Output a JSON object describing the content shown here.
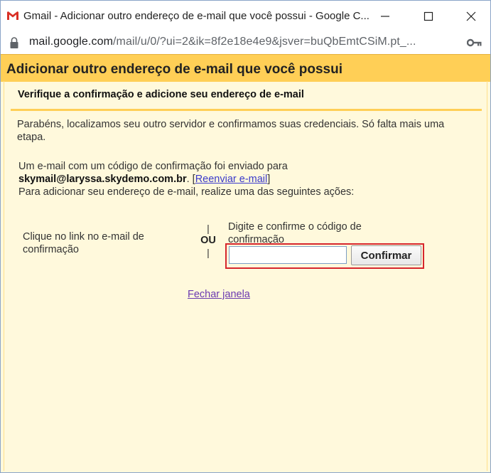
{
  "window": {
    "title": "Gmail - Adicionar outro endereço de e-mail que você possui - Google C...",
    "icon": "gmail-logo",
    "controls": [
      "minimize-icon",
      "maximize-icon",
      "close-icon"
    ]
  },
  "addressbar": {
    "url_host": "mail.google.com",
    "url_rest": "/mail/u/0/?ui=2&ik=8f2e18e4e9&jsver=buQbEmtCSiM.pt_...",
    "lock_icon": "lock-icon",
    "key_icon": "key-icon"
  },
  "dialog": {
    "heading": "Adicionar outro endereço de e-mail que você possui",
    "subheading": "Verifique a confirmação e adicione seu endereço de e-mail",
    "intro": "Parabéns, localizamos seu outro servidor e confirmamos suas credenciais. Só falta mais uma etapa.",
    "sent_text": "Um e-mail com um código de confirmação foi enviado para",
    "email": "skymail@laryssa.skydemo.com.br",
    "resend_open": ". [",
    "resend_link": "Reenviar e-mail",
    "resend_close": "]",
    "instruction": "Para adicionar seu endereço de e-mail, realize uma das seguintes ações:",
    "option_left": "Clique no link no e-mail de confirmação",
    "or_bar": "|",
    "or_label": "OU",
    "option_right_label": "Digite e confirme o código de confirmação",
    "code_value": "",
    "confirm_label": "Confirmar",
    "close_link": "Fechar janela"
  },
  "colors": {
    "header_bg": "#ffcf56",
    "panel_bg": "#fff9dc",
    "highlight_border": "#d6262c",
    "link": "#3a3acb",
    "visited_link": "#6a3ab0"
  }
}
